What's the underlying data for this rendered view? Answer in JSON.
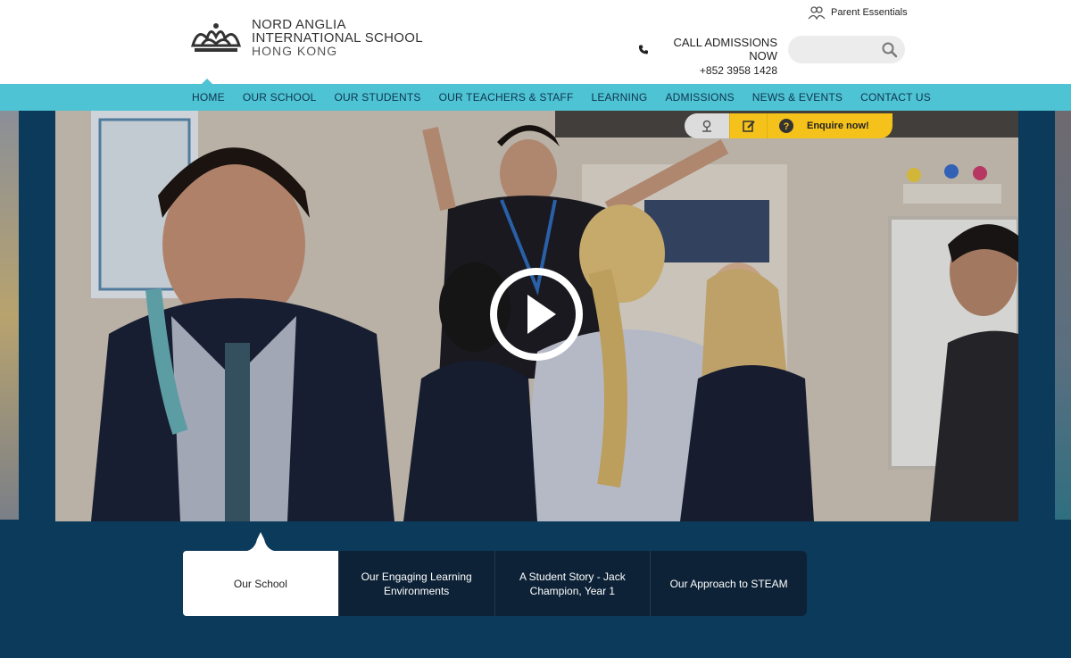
{
  "brand": {
    "line1": "NORD ANGLIA",
    "line2": "INTERNATIONAL SCHOOL",
    "line3": "HONG KONG"
  },
  "utility": {
    "parent_essentials": "Parent Essentials",
    "call_label": "CALL ADMISSIONS NOW",
    "phone": "+852 3958 1428",
    "search_placeholder": ""
  },
  "nav": {
    "items": [
      {
        "label": "HOME"
      },
      {
        "label": "OUR SCHOOL"
      },
      {
        "label": "OUR STUDENTS"
      },
      {
        "label": "OUR TEACHERS & STAFF"
      },
      {
        "label": "LEARNING"
      },
      {
        "label": "ADMISSIONS"
      },
      {
        "label": "NEWS & EVENTS"
      },
      {
        "label": "CONTACT US"
      }
    ],
    "active_index": 0
  },
  "hero": {
    "enquire_label": "Enquire now!"
  },
  "tabs": [
    {
      "label": "Our School",
      "active": true
    },
    {
      "label": "Our Engaging Learning Environments",
      "active": false
    },
    {
      "label": "A Student Story - Jack Champion, Year 1",
      "active": false
    },
    {
      "label": "Our Approach to STEAM",
      "active": false
    }
  ],
  "colors": {
    "nav_bg": "#4ec3d3",
    "page_bg": "#0b3a5b",
    "accent_yellow": "#f5c21b",
    "tab_dark": "#0d2236"
  }
}
